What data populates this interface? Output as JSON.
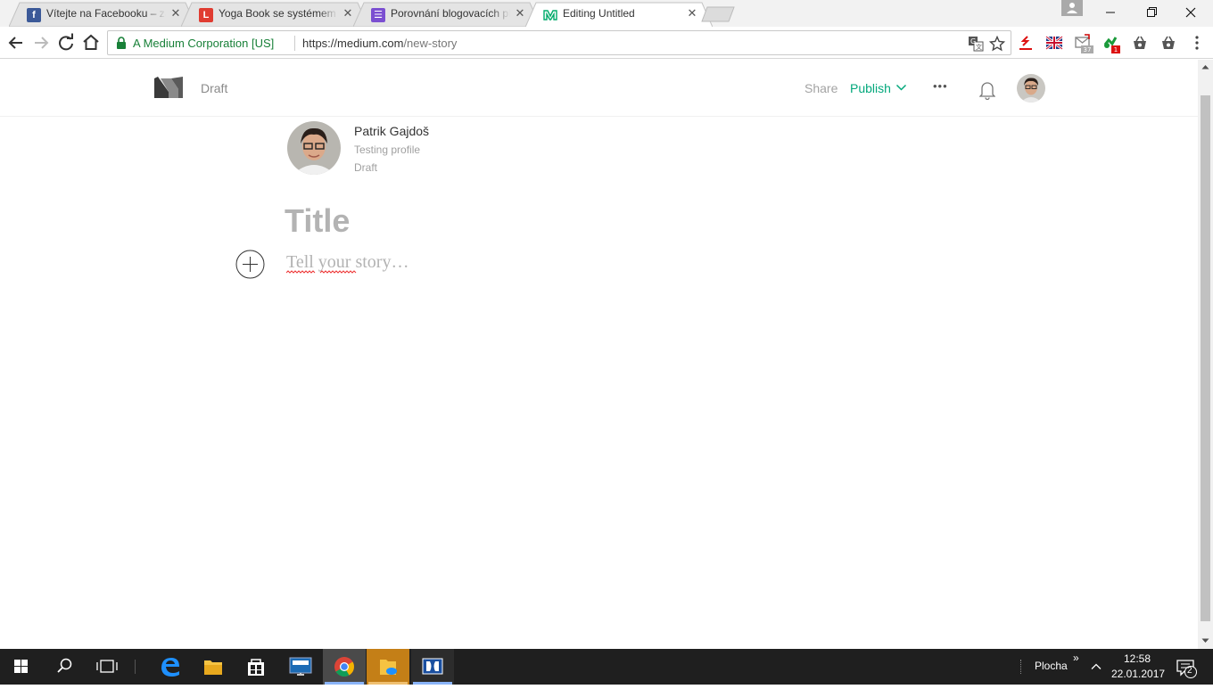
{
  "browser": {
    "tabs": [
      {
        "title": "Vítejte na Facebooku – zaregistrujte se",
        "icon": "facebook-icon",
        "icon_color": "#3b5998",
        "icon_glyph": "f"
      },
      {
        "title": "Yoga Book se systémem Windows",
        "icon": "lifehacky-icon",
        "icon_color": "#e03c31",
        "icon_glyph": "L"
      },
      {
        "title": "Porovnání blogovacích platforem",
        "icon": "forms-icon",
        "icon_color": "#7b4fd1",
        "icon_glyph": "☰"
      },
      {
        "title": "Editing Untitled",
        "icon": "medium-icon",
        "icon_color": "#00ab6b",
        "icon_glyph": "M",
        "active": true
      }
    ],
    "security_label": "A Medium Corporation [US]",
    "url_host": "https://medium.com",
    "url_path": "/new-story",
    "extension_badges": {
      "mail_count": "37",
      "green_count": "1"
    }
  },
  "medium": {
    "header": {
      "status": "Draft",
      "share_label": "Share",
      "publish_label": "Publish",
      "more_label": "•••",
      "accent_color": "#03a87c"
    },
    "author": {
      "name": "Patrik Gajdoš",
      "bio": "Testing profile",
      "status": "Draft"
    },
    "editor": {
      "title_placeholder": "Title",
      "body_placeholder": "Tell your story…"
    }
  },
  "taskbar": {
    "desktop_label": "Plocha",
    "chevron": "»",
    "time": "12:58",
    "date": "22.01.2017",
    "notification_count": "2"
  }
}
